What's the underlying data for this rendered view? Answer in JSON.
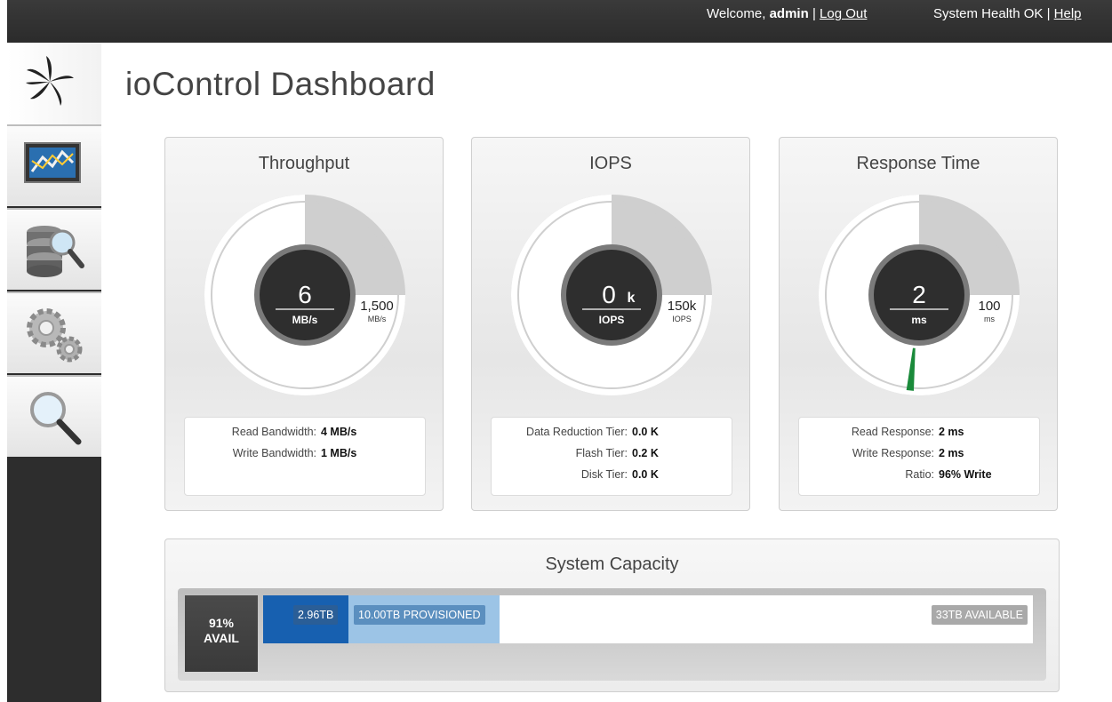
{
  "topbar": {
    "welcome_prefix": "Welcome,",
    "username": "admin",
    "separator1": "|",
    "logout": "Log Out",
    "health": "System Health OK",
    "separator2": "|",
    "help": "Help"
  },
  "sidebar": {
    "items": [
      {
        "icon": "logo-icon"
      },
      {
        "icon": "performance-chart-icon"
      },
      {
        "icon": "storage-search-icon"
      },
      {
        "icon": "settings-gears-icon"
      },
      {
        "icon": "magnifier-icon"
      }
    ]
  },
  "page": {
    "title": "ioControl Dashboard"
  },
  "throughput": {
    "title": "Throughput",
    "value": "6",
    "unit": "MB/s",
    "max": "1,500",
    "max_unit": "MB/s",
    "level": 0.004,
    "stats": [
      {
        "label": "Read Bandwidth:",
        "value": "4 MB/s"
      },
      {
        "label": "Write Bandwidth:",
        "value": "1 MB/s"
      }
    ]
  },
  "iops": {
    "title": "IOPS",
    "value": "0",
    "suffix": "k",
    "unit": "IOPS",
    "max": "150k",
    "max_unit": "IOPS",
    "level": 0.0,
    "stats": [
      {
        "label": "Data Reduction Tier:",
        "value": "0.0 K"
      },
      {
        "label": "Flash Tier:",
        "value": "0.2 K"
      },
      {
        "label": "Disk Tier:",
        "value": "0.0 K"
      }
    ]
  },
  "response": {
    "title": "Response Time",
    "value": "2",
    "unit": "ms",
    "max": "100",
    "max_unit": "ms",
    "level": 0.02,
    "accent": "#1a8a3a",
    "stats": [
      {
        "label": "Read Response:",
        "value": "2 ms"
      },
      {
        "label": "Write Response:",
        "value": "2 ms"
      },
      {
        "label": "Ratio:",
        "value": "96% Write"
      }
    ]
  },
  "capacity": {
    "title": "System Capacity",
    "avail_pct": "91%",
    "avail_label": "AVAIL",
    "used": "2.96TB",
    "provisioned": "10.00TB PROVISIONED",
    "available": "33TB AVAILABLE",
    "colors": {
      "used": "#1760b0",
      "provisioned": "#9cc4e6"
    }
  }
}
